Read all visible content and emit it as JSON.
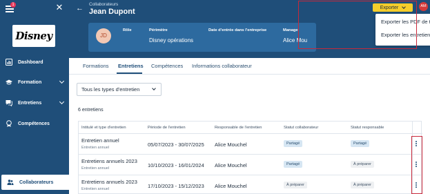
{
  "sidebar": {
    "notification_count": "1",
    "logo_text": "Disney",
    "items": [
      {
        "label": "Dashboard"
      },
      {
        "label": "Formation"
      },
      {
        "label": "Entretiens"
      },
      {
        "label": "Compétences"
      },
      {
        "label": "Collaborateurs"
      }
    ]
  },
  "header": {
    "breadcrumb": "Collaborateurs",
    "name": "Jean Dupont",
    "avatar_initials": "JD",
    "columns": [
      {
        "label": "Rôle",
        "value": ""
      },
      {
        "label": "Périmètre",
        "value": "Disney opérations"
      },
      {
        "label": "Date d'entrée dans l'entreprise",
        "value": ""
      },
      {
        "label": "Manage",
        "value": "Alice Mou"
      }
    ],
    "export_label": "Exporter",
    "user_initials": "AM"
  },
  "dropdown": {
    "items": [
      "Exporter les PDF de tous les entretiens",
      "Exporter les entretiens de la vue active"
    ]
  },
  "tabs": [
    "Formations",
    "Entretiens",
    "Compétences",
    "Informations collaborateur"
  ],
  "filter": {
    "value": "Tous les types d'entretien"
  },
  "count_text": "6 entretiens",
  "table": {
    "headers": [
      "Intitulé et type d'entretien",
      "Période de l'entretien",
      "Responsable de l'entretien",
      "Statut collaborateur",
      "Statut responsable"
    ],
    "rows": [
      {
        "title": "Entretien annuel",
        "type": "Entretien annuel",
        "period": "05/07/2023 - 30/07/2025",
        "manager": "Alice Mouchel",
        "status_collab": "Partagé",
        "status_resp": "Partagé"
      },
      {
        "title": "Entretiens annuels 2023",
        "type": "Entretien annuel",
        "period": "10/10/2023 - 16/01/2024",
        "manager": "Alice Mouchel",
        "status_collab": "Partagé",
        "status_resp": "À préparer"
      },
      {
        "title": "Entretiens annuels 2023",
        "type": "Entretien annuel",
        "period": "17/10/2023 - 15/12/2023",
        "manager": "Alice Mouchel",
        "status_collab": "À préparer",
        "status_resp": "À préparer"
      }
    ]
  },
  "colors": {
    "sidebar": "#1f4e79",
    "accent": "#f5cd2b",
    "highlight": "#c8283a"
  }
}
